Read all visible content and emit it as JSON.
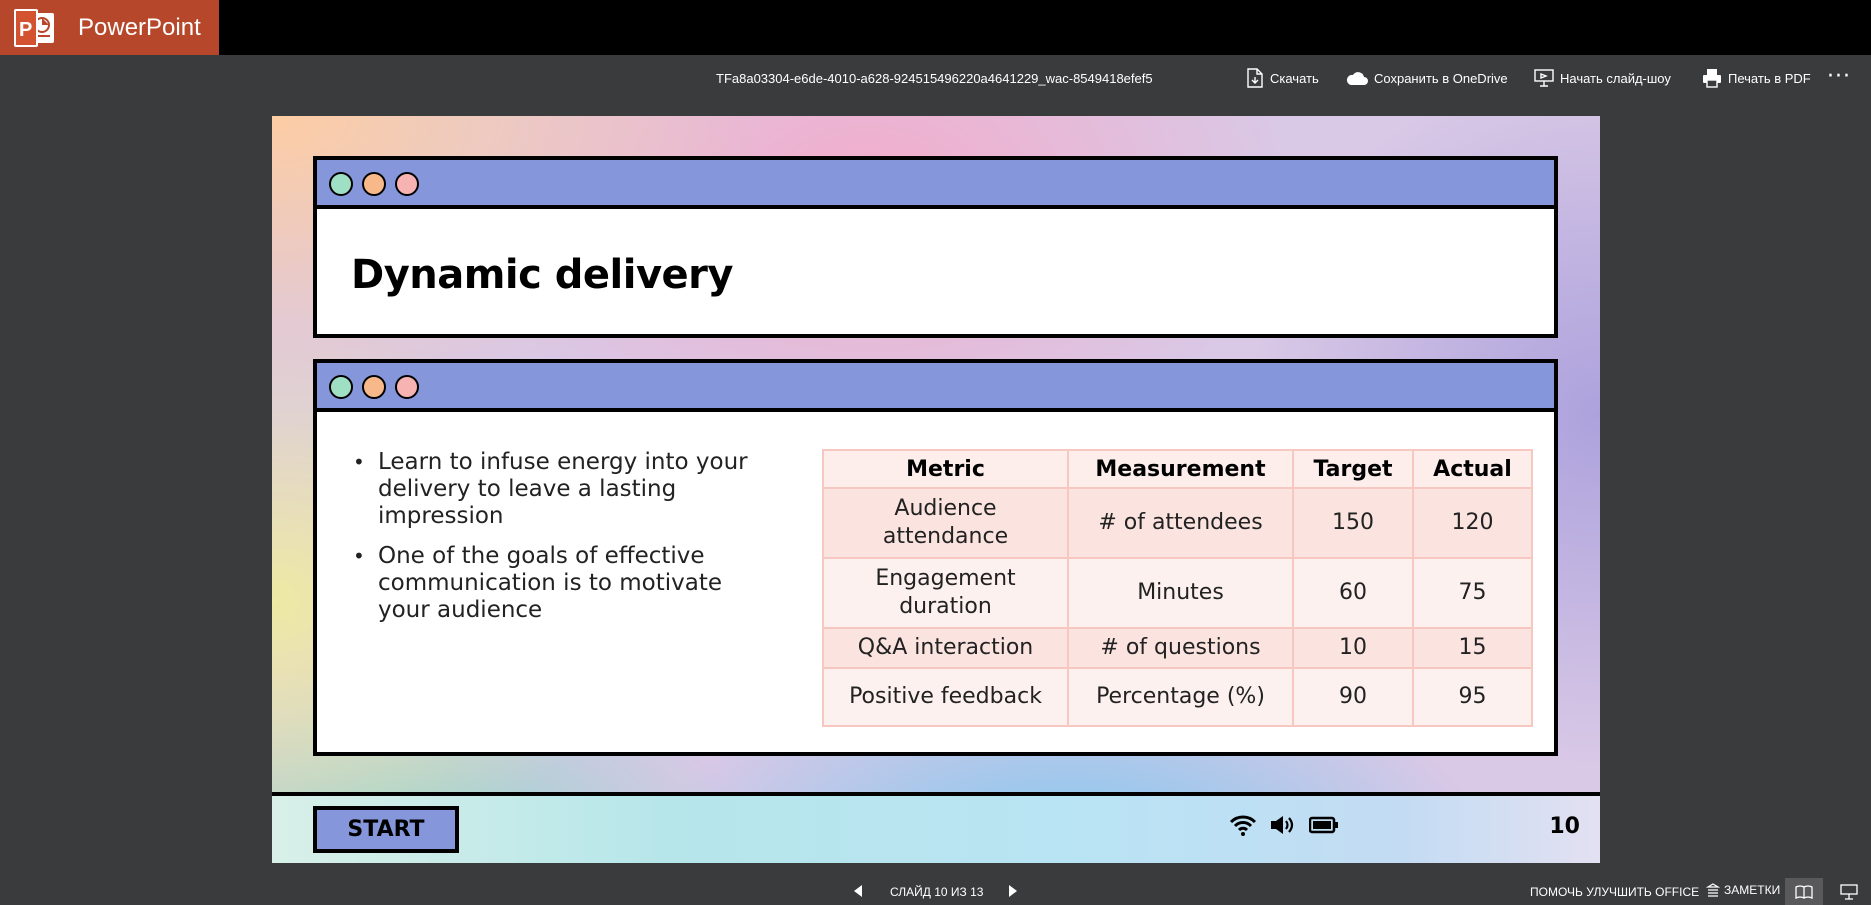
{
  "app": {
    "name": "PowerPoint",
    "brand_color": "#b7472a"
  },
  "file": {
    "name": "TFa8a03304-e6de-4010-a628-924515496220a4641229_wac-8549418efef5"
  },
  "toolbar": {
    "download": "Скачать",
    "save_onedrive": "Сохранить в OneDrive",
    "start_slideshow": "Начать слайд-шоу",
    "print_pdf": "Печать в PDF",
    "more": "···"
  },
  "slide": {
    "title": "Dynamic delivery",
    "bullets": [
      "Learn to infuse energy into your delivery to leave a lasting impression",
      "One of the goals of effective communication is to motivate your audience"
    ],
    "table": {
      "headers": [
        "Metric",
        "Measurement",
        "Target",
        "Actual"
      ],
      "rows": [
        [
          "Audience attendance",
          "# of attendees",
          "150",
          "120"
        ],
        [
          "Engagement duration",
          "Minutes",
          "60",
          "75"
        ],
        [
          "Q&A interaction",
          "# of questions",
          "10",
          "15"
        ],
        [
          "Positive feedback",
          "Percentage (%)",
          "90",
          "95"
        ]
      ]
    },
    "start_label": "START",
    "page_number": "10",
    "icons": [
      "wifi-icon",
      "speaker-icon",
      "battery-icon"
    ],
    "window_dots": [
      "#9fe0c4",
      "#f8b98a",
      "#f7b3b2"
    ],
    "accent_color": "#8596db"
  },
  "status": {
    "slide_counter": "СЛАЙД 10 ИЗ 13",
    "help_improve": "ПОМОЧЬ УЛУЧШИТЬ OFFICE",
    "notes": "ЗАМЕТКИ"
  }
}
